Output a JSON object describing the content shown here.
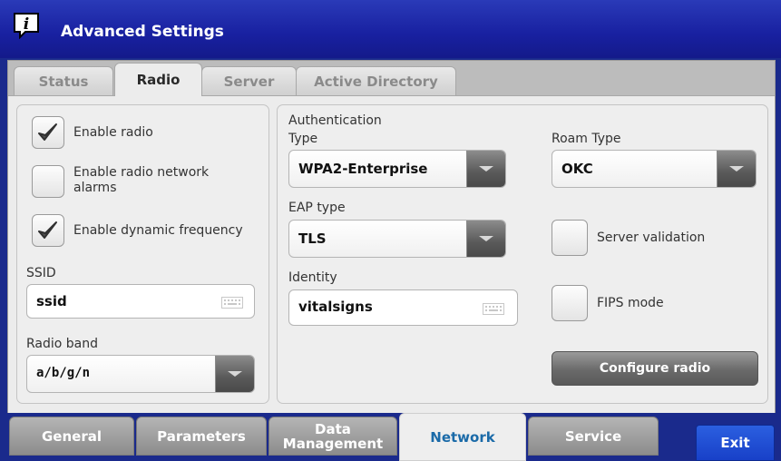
{
  "window": {
    "title": "Advanced Settings",
    "icon": "info-speech-bubble-icon"
  },
  "tabs": [
    {
      "label": "Status",
      "active": false
    },
    {
      "label": "Radio",
      "active": true
    },
    {
      "label": "Server",
      "active": false
    },
    {
      "label": "Active Directory",
      "active": false
    }
  ],
  "radio_panel": {
    "enable_radio": {
      "label": "Enable radio",
      "checked": true
    },
    "enable_alarms": {
      "label": "Enable radio network alarms",
      "checked": false
    },
    "enable_dynamic_frequency": {
      "label": "Enable dynamic frequency",
      "checked": true
    },
    "ssid": {
      "label": "SSID",
      "value": "ssid"
    },
    "radio_band": {
      "label": "Radio band",
      "value": "a/b/g/n"
    }
  },
  "auth_panel": {
    "heading": "Authentication",
    "type": {
      "label": "Type",
      "value": "WPA2-Enterprise"
    },
    "eap_type": {
      "label": "EAP type",
      "value": "TLS"
    },
    "identity": {
      "label": "Identity",
      "value": "vitalsigns"
    },
    "roam_type": {
      "label": "Roam Type",
      "value": "OKC"
    },
    "server_validation": {
      "label": "Server validation",
      "checked": false
    },
    "fips_mode": {
      "label": "FIPS mode",
      "checked": false
    },
    "configure_button": "Configure radio"
  },
  "bottom_nav": [
    {
      "label": "General",
      "active": false
    },
    {
      "label": "Parameters",
      "active": false
    },
    {
      "label": "Data\nManagement",
      "active": false
    },
    {
      "label": "Network",
      "active": true
    },
    {
      "label": "Service",
      "active": false
    }
  ],
  "exit_label": "Exit",
  "colors": {
    "titlebar": "#1a2a8c",
    "accent": "#1a6aa8",
    "exit": "#1840c8"
  }
}
